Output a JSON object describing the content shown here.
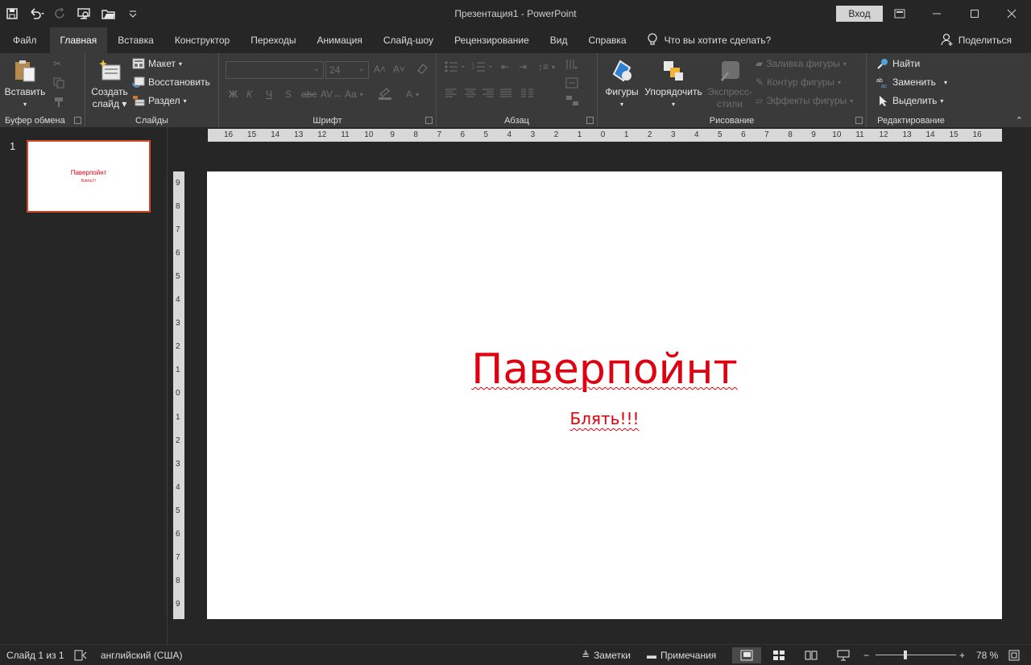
{
  "window": {
    "title": "Презентация1  -  PowerPoint",
    "signin_label": "Вход"
  },
  "tabs": {
    "file": "Файл",
    "items": [
      "Главная",
      "Вставка",
      "Конструктор",
      "Переходы",
      "Анимация",
      "Слайд-шоу",
      "Рецензирование",
      "Вид",
      "Справка"
    ],
    "active": "Главная",
    "tell_me": "Что вы хотите сделать?",
    "share": "Поделиться"
  },
  "ribbon": {
    "clipboard": {
      "label": "Буфер обмена",
      "paste": "Вставить"
    },
    "slides": {
      "label": "Слайды",
      "new_slide_1": "Создать",
      "new_slide_2": "слайд",
      "layout": "Макет",
      "reset": "Восстановить",
      "section": "Раздел"
    },
    "font": {
      "label": "Шрифт",
      "size": "24",
      "bold": "Ж",
      "italic": "К",
      "underline": "Ч",
      "strike": "S",
      "case": "Aa"
    },
    "paragraph": {
      "label": "Абзац"
    },
    "drawing": {
      "label": "Рисование",
      "shapes": "Фигуры",
      "arrange": "Упорядочить",
      "quick_styles_1": "Экспресс-",
      "quick_styles_2": "стили",
      "fill": "Заливка фигуры",
      "outline": "Контур фигуры",
      "effects": "Эффекты фигуры"
    },
    "editing": {
      "label": "Редактирование",
      "find": "Найти",
      "replace": "Заменить",
      "select": "Выделить"
    }
  },
  "slides_pane": {
    "number": "1",
    "thumb_title": "Паверпойнт",
    "thumb_sub": "Блять!!!"
  },
  "rulers": {
    "horizontal": [
      "16",
      "15",
      "14",
      "13",
      "12",
      "11",
      "10",
      "9",
      "8",
      "7",
      "6",
      "5",
      "4",
      "3",
      "2",
      "1",
      "0",
      "1",
      "2",
      "3",
      "4",
      "5",
      "6",
      "7",
      "8",
      "9",
      "10",
      "11",
      "12",
      "13",
      "14",
      "15",
      "16"
    ],
    "vertical": [
      "9",
      "8",
      "7",
      "6",
      "5",
      "4",
      "3",
      "2",
      "1",
      "0",
      "1",
      "2",
      "3",
      "4",
      "5",
      "6",
      "7",
      "8",
      "9"
    ]
  },
  "slide": {
    "title": "Паверпойнт",
    "subtitle": "Блять!!!"
  },
  "status": {
    "slide_of": "Слайд 1 из 1",
    "language": "английский (США)",
    "notes": "Заметки",
    "comments": "Примечания",
    "zoom_minus": "−",
    "zoom_plus": "+",
    "zoom": "78 %",
    "zoom_value": 78
  },
  "colors": {
    "accent": "#d24726",
    "slide_text": "#e0000f",
    "ribbon_bg": "#3a3a3a",
    "app_bg": "#262626"
  }
}
